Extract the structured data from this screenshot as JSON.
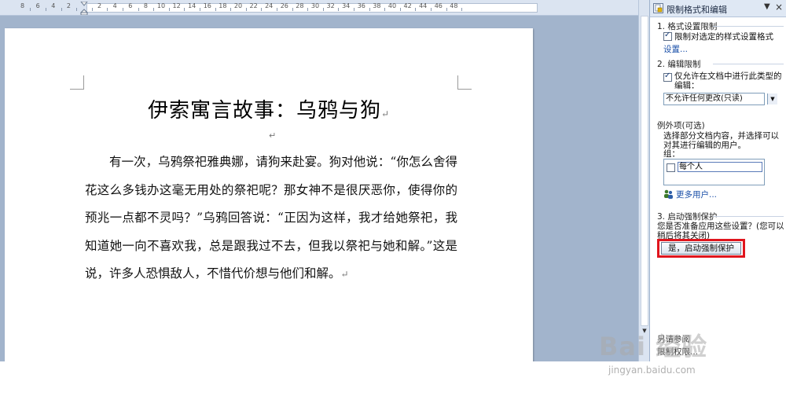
{
  "ruler": {
    "labels": [
      "8",
      "6",
      "4",
      "2",
      "",
      "2",
      "4",
      "6",
      "8",
      "10",
      "12",
      "14",
      "16",
      "18",
      "20",
      "22",
      "24",
      "26",
      "28",
      "30",
      "32",
      "34",
      "36",
      "38",
      "40",
      "42",
      "44",
      "46",
      "48"
    ]
  },
  "document": {
    "title": "伊索寓言故事：乌鸦与狗",
    "paragraph_mark": "↵",
    "body": "有一次，乌鸦祭祀雅典娜，请狗来赴宴。狗对他说：“你怎么舍得花这么多钱办这毫无用处的祭祀呢？那女神不是很厌恶你，使得你的预兆一点都不灵吗？”乌鸦回答说：“正因为这样，我才给她祭祀，我知道她一向不喜欢我，总是跟我过不去，但我以祭祀与她和解。”这是说，许多人恐惧敌人，不惜代价想与他们和解。"
  },
  "pane": {
    "title": "限制格式和编辑",
    "dropdown_icon": "▼",
    "close_icon": "×",
    "section1": {
      "title": "1. 格式设置限制",
      "checkbox_label": "限制对选定的样式设置格式",
      "settings_link": "设置..."
    },
    "section2": {
      "title": "2. 编辑限制",
      "checkbox_label": "仅允许在文档中进行此类型的编辑：",
      "select_value": "不允许任何更改(只读)"
    },
    "exceptions": {
      "title": "例外项(可选)",
      "description": "选择部分文档内容，并选择可以对其进行编辑的用户。",
      "groups_label": "组：",
      "everyone": "每个人",
      "more_users": "更多用户..."
    },
    "section3": {
      "title": "3. 启动强制保护",
      "question": "您是否准备应用这些设置？(您可以稍后将其关闭)",
      "button_label": "是，启动强制保护"
    },
    "bottom": {
      "item1": "另请参阅",
      "item2": "限制权限..."
    }
  },
  "watermark": {
    "text": "Bai 经验",
    "url": "jingyan.baidu.com"
  },
  "colors": {
    "workspace": "#a2b4cc",
    "highlight_frame": "#e0151d",
    "link": "#1a4fa8"
  }
}
